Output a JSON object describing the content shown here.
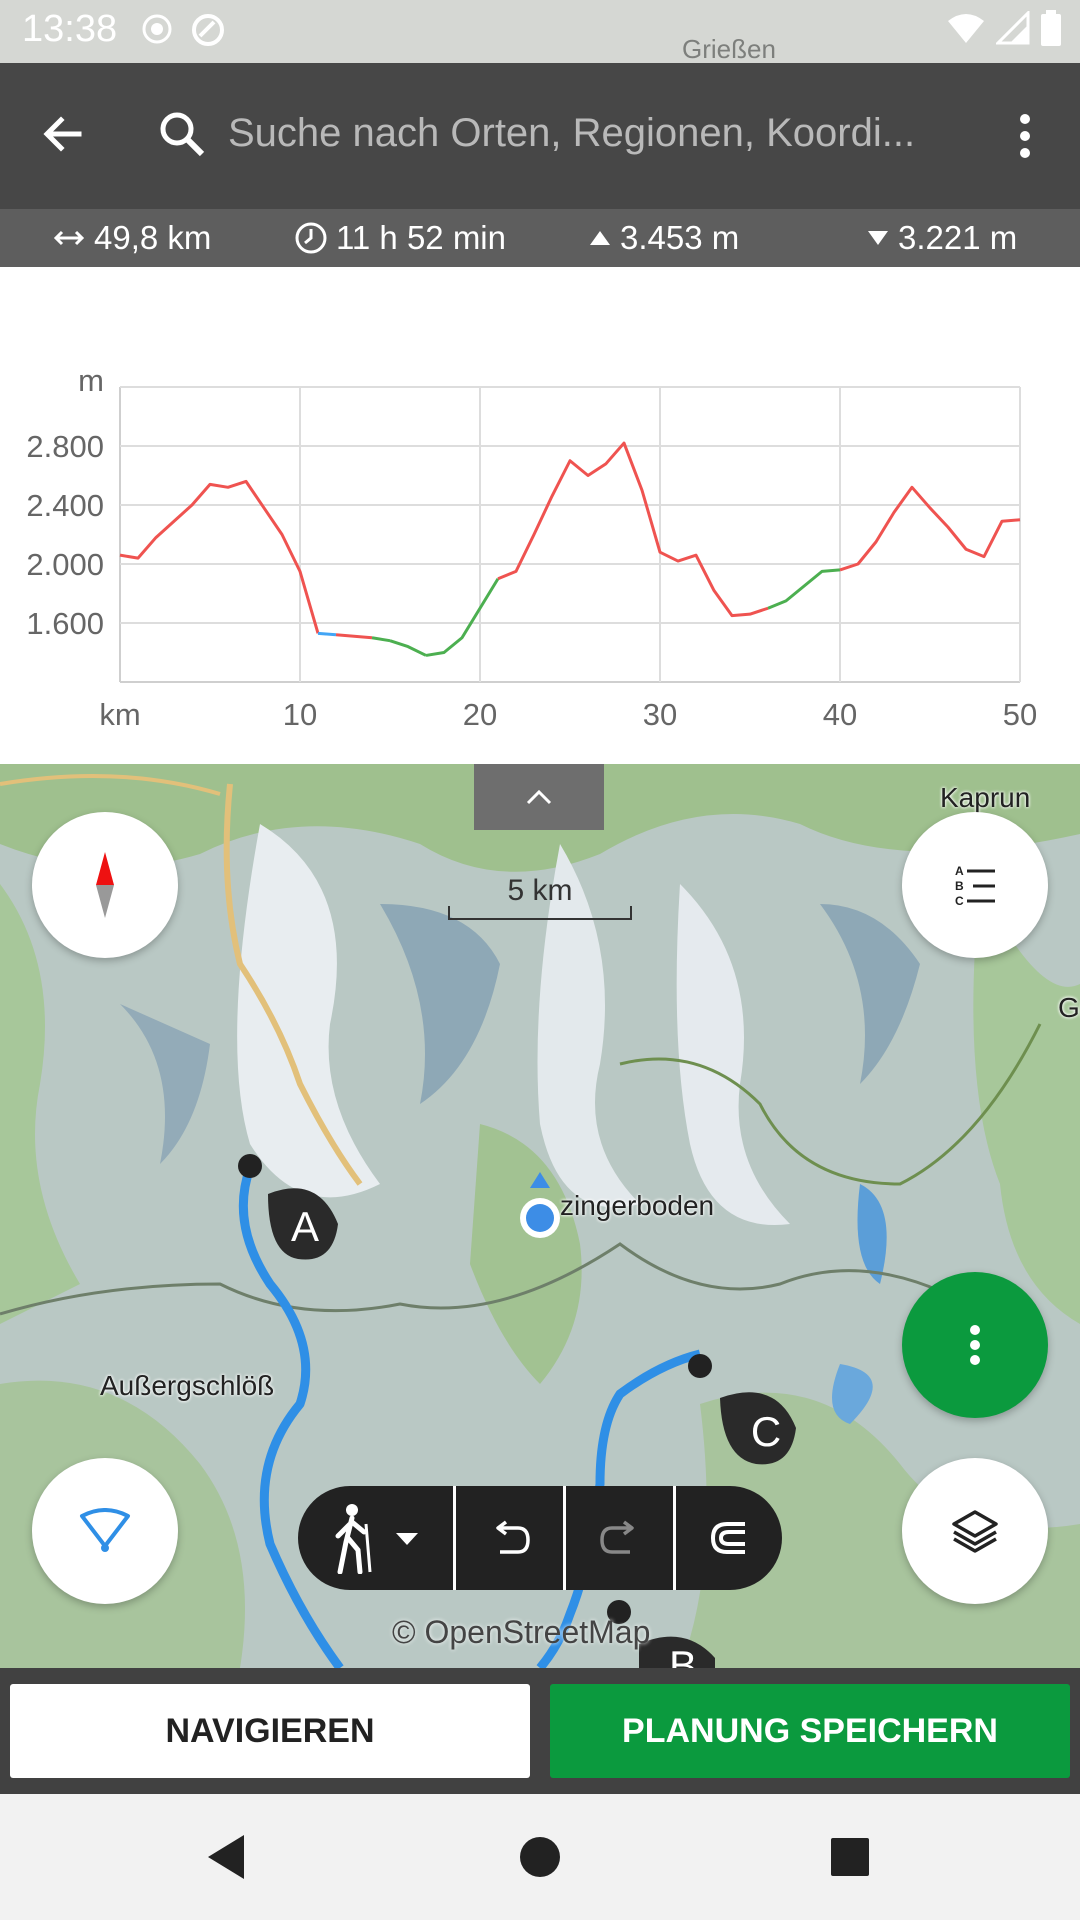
{
  "status_bar": {
    "time": "13:38",
    "map_label": "Grießen",
    "icons": [
      "record-icon",
      "sync-icon",
      "wifi-icon",
      "signal-icon",
      "battery-icon"
    ]
  },
  "app_bar": {
    "back_icon": "arrow-left-icon",
    "search_placeholder": "Suche nach Orten, Regionen, Koordi...",
    "menu_icon": "more-vert-icon"
  },
  "stats": {
    "distance": "49,8 km",
    "duration": "11 h 52 min",
    "ascent": "3.453 m",
    "descent": "3.221 m"
  },
  "chart_data": {
    "type": "line",
    "title": "",
    "xlabel": "km",
    "ylabel": "m",
    "xlim": [
      0,
      50
    ],
    "ylim": [
      1200,
      3200
    ],
    "x_ticks": [
      "10",
      "20",
      "30",
      "40",
      "50"
    ],
    "y_ticks": [
      "1.600",
      "2.000",
      "2.400",
      "2.800"
    ],
    "grid": true,
    "series": [
      {
        "x": [
          0,
          1,
          2,
          3,
          4,
          5,
          6,
          7,
          8,
          9,
          10,
          11,
          12,
          13,
          14,
          15,
          16,
          17,
          18,
          19,
          20,
          21,
          22,
          23,
          24,
          25,
          26,
          27,
          28,
          29,
          30,
          31,
          32,
          33,
          34,
          35,
          36,
          37,
          38,
          39,
          40,
          41,
          42,
          43,
          44,
          45,
          46,
          47,
          48,
          49,
          50
        ],
        "y": [
          2060,
          2040,
          2180,
          2290,
          2400,
          2540,
          2520,
          2560,
          2380,
          2200,
          1950,
          1530,
          1520,
          1510,
          1500,
          1480,
          1440,
          1380,
          1400,
          1500,
          1700,
          1900,
          1950,
          2200,
          2460,
          2700,
          2600,
          2680,
          2820,
          2500,
          2080,
          2020,
          2060,
          1820,
          1650,
          1660,
          1700,
          1750,
          1850,
          1950,
          1960,
          2000,
          2150,
          2350,
          2520,
          2380,
          2250,
          2100,
          2050,
          2290,
          2300
        ]
      }
    ],
    "color_segments": [
      {
        "from_km": 0,
        "to_km": 11,
        "color": "#ef5350"
      },
      {
        "from_km": 11,
        "to_km": 12,
        "color": "#42a5f5"
      },
      {
        "from_km": 12,
        "to_km": 14,
        "color": "#ef5350"
      },
      {
        "from_km": 14,
        "to_km": 15,
        "color": "#4caf50"
      },
      {
        "from_km": 15,
        "to_km": 17,
        "color": "#4caf50"
      },
      {
        "from_km": 17,
        "to_km": 21,
        "color": "#4caf50"
      },
      {
        "from_km": 21,
        "to_km": 36,
        "color": "#ef5350"
      },
      {
        "from_km": 36,
        "to_km": 40,
        "color": "#4caf50"
      },
      {
        "from_km": 40,
        "to_km": 50,
        "color": "#ef5350"
      }
    ]
  },
  "map": {
    "labels": {
      "kaprun": "Kaprun",
      "aussergschloess": "Außergschlöß",
      "zingerboden": "zingerboden",
      "edge_right": "Gr"
    },
    "scale_label": "5 km",
    "waypoints": {
      "a": "A",
      "b": "B",
      "c": "C"
    },
    "copyright": "© OpenStreetMap",
    "route_color": "#2f8fe6",
    "location_color": "#3d8de6"
  },
  "buttons": {
    "navigate": "NAVIGIEREN",
    "save_planning": "PLANUNG SPEICHERN",
    "accent": "#0b9a3e"
  }
}
